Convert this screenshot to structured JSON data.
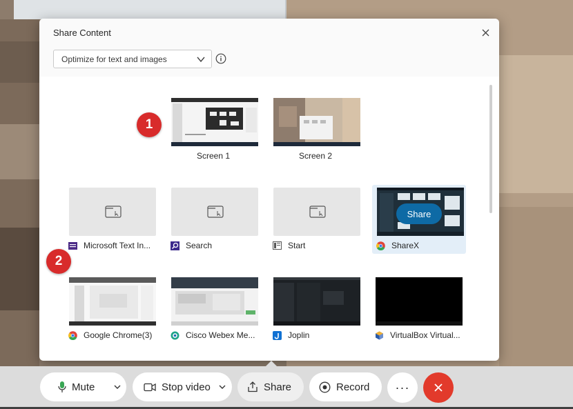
{
  "dialog": {
    "title": "Share Content",
    "close_label": "×",
    "optimize": {
      "selected": "Optimize for text and images"
    }
  },
  "screens": [
    {
      "label": "Screen 1"
    },
    {
      "label": "Screen 2"
    }
  ],
  "apps_row1": [
    {
      "label": "Microsoft Text In...",
      "icon": "microsoft-text-input-icon"
    },
    {
      "label": "Search",
      "icon": "search-app-icon"
    },
    {
      "label": "Start",
      "icon": "start-app-icon"
    },
    {
      "label": "ShareX",
      "icon": "chrome-icon",
      "selected": true,
      "share_label": "Share"
    }
  ],
  "apps_row2": [
    {
      "label": "Google Chrome(3)",
      "icon": "chrome-icon"
    },
    {
      "label": "Cisco Webex Me...",
      "icon": "webex-icon"
    },
    {
      "label": "Joplin",
      "icon": "joplin-icon"
    },
    {
      "label": "VirtualBox Virtual...",
      "icon": "virtualbox-icon"
    }
  ],
  "markers": [
    "1",
    "2"
  ],
  "toolbar": {
    "mute": "Mute",
    "stop_video": "Stop video",
    "share": "Share",
    "record": "Record",
    "more": "···"
  },
  "colors": {
    "accent": "#0e6aa5",
    "end_call": "#e23a2b",
    "marker": "#d82b2b",
    "mic": "#3aa655"
  }
}
